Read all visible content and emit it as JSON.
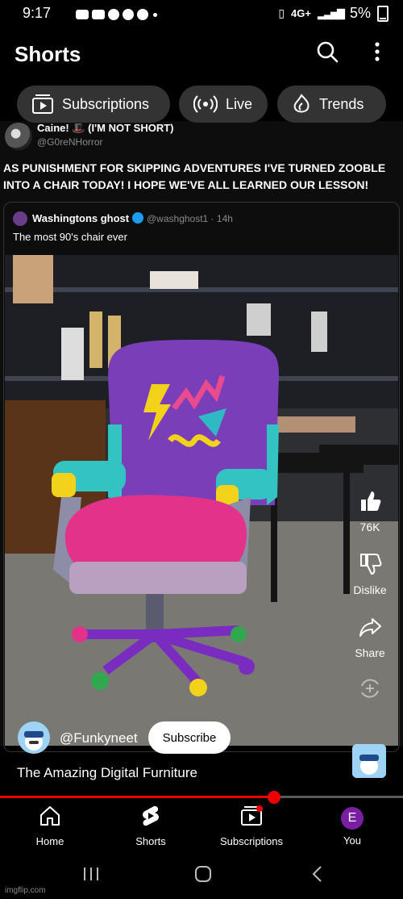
{
  "status_bar": {
    "time": "9:17",
    "network": "4G+",
    "battery": "5%"
  },
  "header": {
    "title": "Shorts",
    "search_icon": "search-icon",
    "more_icon": "more-vert-icon"
  },
  "chips": [
    {
      "label": "Subscriptions",
      "icon": "subscriptions-icon"
    },
    {
      "label": "Live",
      "icon": "live-icon"
    },
    {
      "label": "Trends",
      "icon": "trends-icon"
    }
  ],
  "tweet": {
    "name": "Caine! 🎩 (I'M NOT SHORT)",
    "handle": "@G0reNHorror",
    "text": "AS PUNISHMENT FOR SKIPPING ADVENTURES I'VE TURNED ZOOBLE INTO A CHAIR TODAY! I HOPE WE'VE ALL LEARNED OUR LESSON!",
    "quoted": {
      "name": "Washingtons ghost",
      "handle": "@washghost1 · 14h",
      "text": "The most 90's chair ever"
    }
  },
  "actions": {
    "like_count": "76K",
    "dislike_label": "Dislike",
    "share_label": "Share"
  },
  "channel": {
    "name": "@Funkyneet",
    "subscribe_label": "Subscribe"
  },
  "video_title": "The Amazing Digital Furniture",
  "progress": {
    "fraction": 0.68
  },
  "bottom_nav": [
    {
      "label": "Home",
      "icon": "home-icon"
    },
    {
      "label": "Shorts",
      "icon": "shorts-icon"
    },
    {
      "label": "Subscriptions",
      "icon": "subscriptions-icon"
    },
    {
      "label": "You",
      "avatar_letter": "E"
    }
  ],
  "watermark": "imgflip.com",
  "colors": {
    "accent_red": "#ee0000",
    "avatar_purple": "#7b1fa2"
  }
}
